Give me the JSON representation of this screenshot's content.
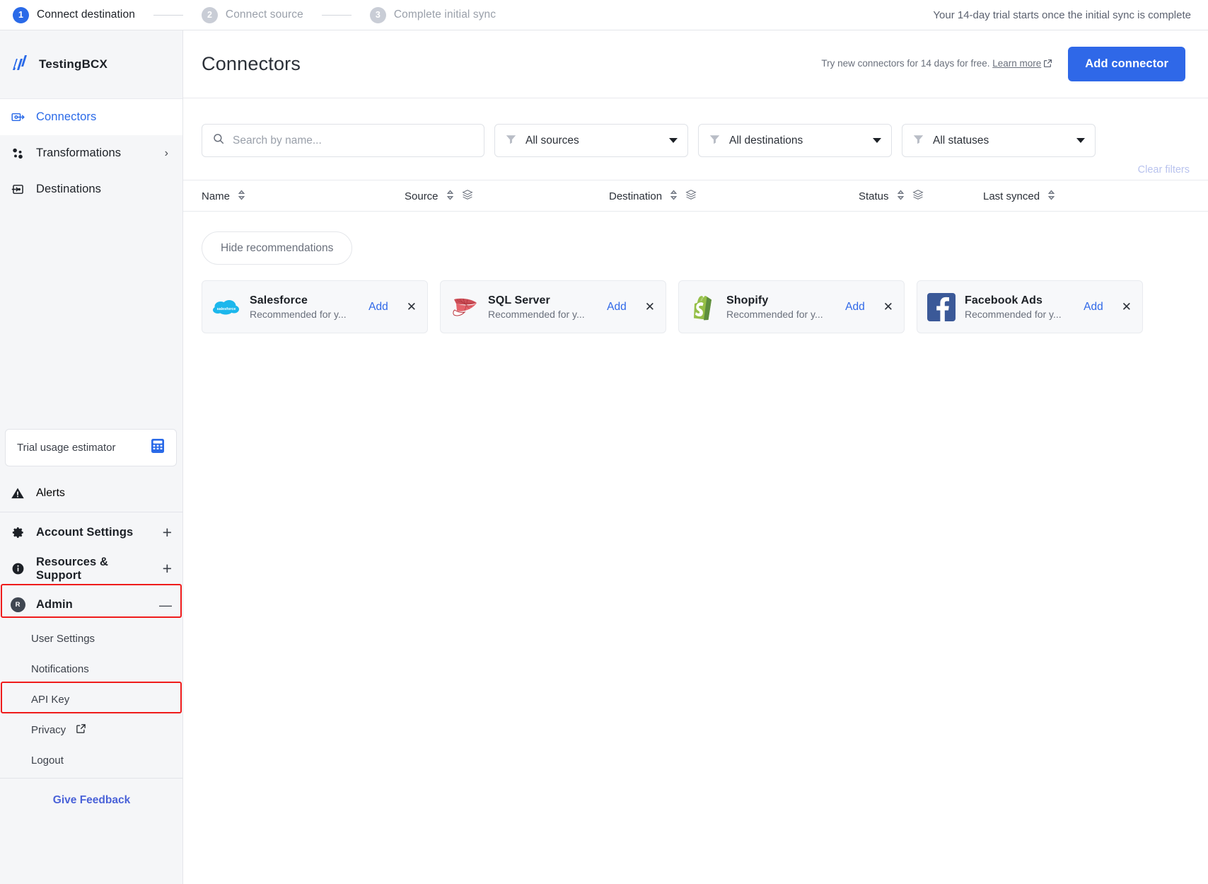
{
  "stepper": {
    "steps": [
      {
        "num": "1",
        "label": "Connect destination",
        "active": true
      },
      {
        "num": "2",
        "label": "Connect source",
        "active": false
      },
      {
        "num": "3",
        "label": "Complete initial sync",
        "active": false
      }
    ],
    "trial_note": "Your 14-day trial starts once the initial sync is complete"
  },
  "sidebar": {
    "brand": {
      "name": "TestingBCX",
      "logo_icon": "fivetran-logo-icon"
    },
    "nav": [
      {
        "label": "Connectors",
        "icon": "connectors-icon",
        "selected": true
      },
      {
        "label": "Transformations",
        "icon": "transformations-icon",
        "selected": false,
        "chevron": "›"
      },
      {
        "label": "Destinations",
        "icon": "destinations-icon",
        "selected": false
      }
    ],
    "trial_card": {
      "label": "Trial usage estimator",
      "icon": "calculator-icon"
    },
    "alerts": {
      "label": "Alerts",
      "icon": "alert-triangle-icon"
    },
    "groups": [
      {
        "label": "Account Settings",
        "icon": "gear-icon",
        "toggle": "+"
      },
      {
        "label": "Resources & Support",
        "icon": "info-icon",
        "toggle": "+"
      },
      {
        "label": "Admin",
        "icon": "admin-avatar-icon",
        "avatar_letter": "R",
        "toggle": "—",
        "highlighted": true
      }
    ],
    "admin_sub_items": [
      {
        "label": "User Settings",
        "highlighted": false
      },
      {
        "label": "Notifications",
        "highlighted": false
      },
      {
        "label": "API Key",
        "highlighted": true
      },
      {
        "label": "Privacy",
        "highlighted": false,
        "external_icon": "external-link-icon"
      },
      {
        "label": "Logout",
        "highlighted": false
      }
    ],
    "give_feedback": "Give Feedback"
  },
  "header": {
    "title": "Connectors",
    "try_note_prefix": "Try new connectors for 14 days for free.",
    "learn_more": "Learn more",
    "add_connector": "Add connector"
  },
  "filters": {
    "search_placeholder": "Search by name...",
    "search_value": "",
    "sources": "All sources",
    "destinations": "All destinations",
    "statuses": "All statuses",
    "clear_filters": "Clear filters"
  },
  "table": {
    "columns": [
      {
        "label": "Name",
        "sort": true,
        "stack": false
      },
      {
        "label": "Source",
        "sort": true,
        "stack": true
      },
      {
        "label": "Destination",
        "sort": true,
        "stack": true
      },
      {
        "label": "Status",
        "sort": true,
        "stack": true
      },
      {
        "label": "Last synced",
        "sort": true,
        "stack": false
      }
    ],
    "rows": []
  },
  "recommendations": {
    "hide_label": "Hide recommendations",
    "add_label": "Add",
    "cards": [
      {
        "name": "Salesforce",
        "subtitle": "Recommended for y...",
        "logo": "salesforce-logo-icon"
      },
      {
        "name": "SQL Server",
        "subtitle": "Recommended for y...",
        "logo": "sqlserver-logo-icon"
      },
      {
        "name": "Shopify",
        "subtitle": "Recommended for y...",
        "logo": "shopify-logo-icon"
      },
      {
        "name": "Facebook Ads",
        "subtitle": "Recommended for y...",
        "logo": "facebook-logo-icon"
      }
    ]
  },
  "colors": {
    "accent_blue": "#2f68e8",
    "highlight_red": "#ef1b1b",
    "sidebar_bg": "#f5f6f8",
    "muted_text": "#6a707c"
  }
}
